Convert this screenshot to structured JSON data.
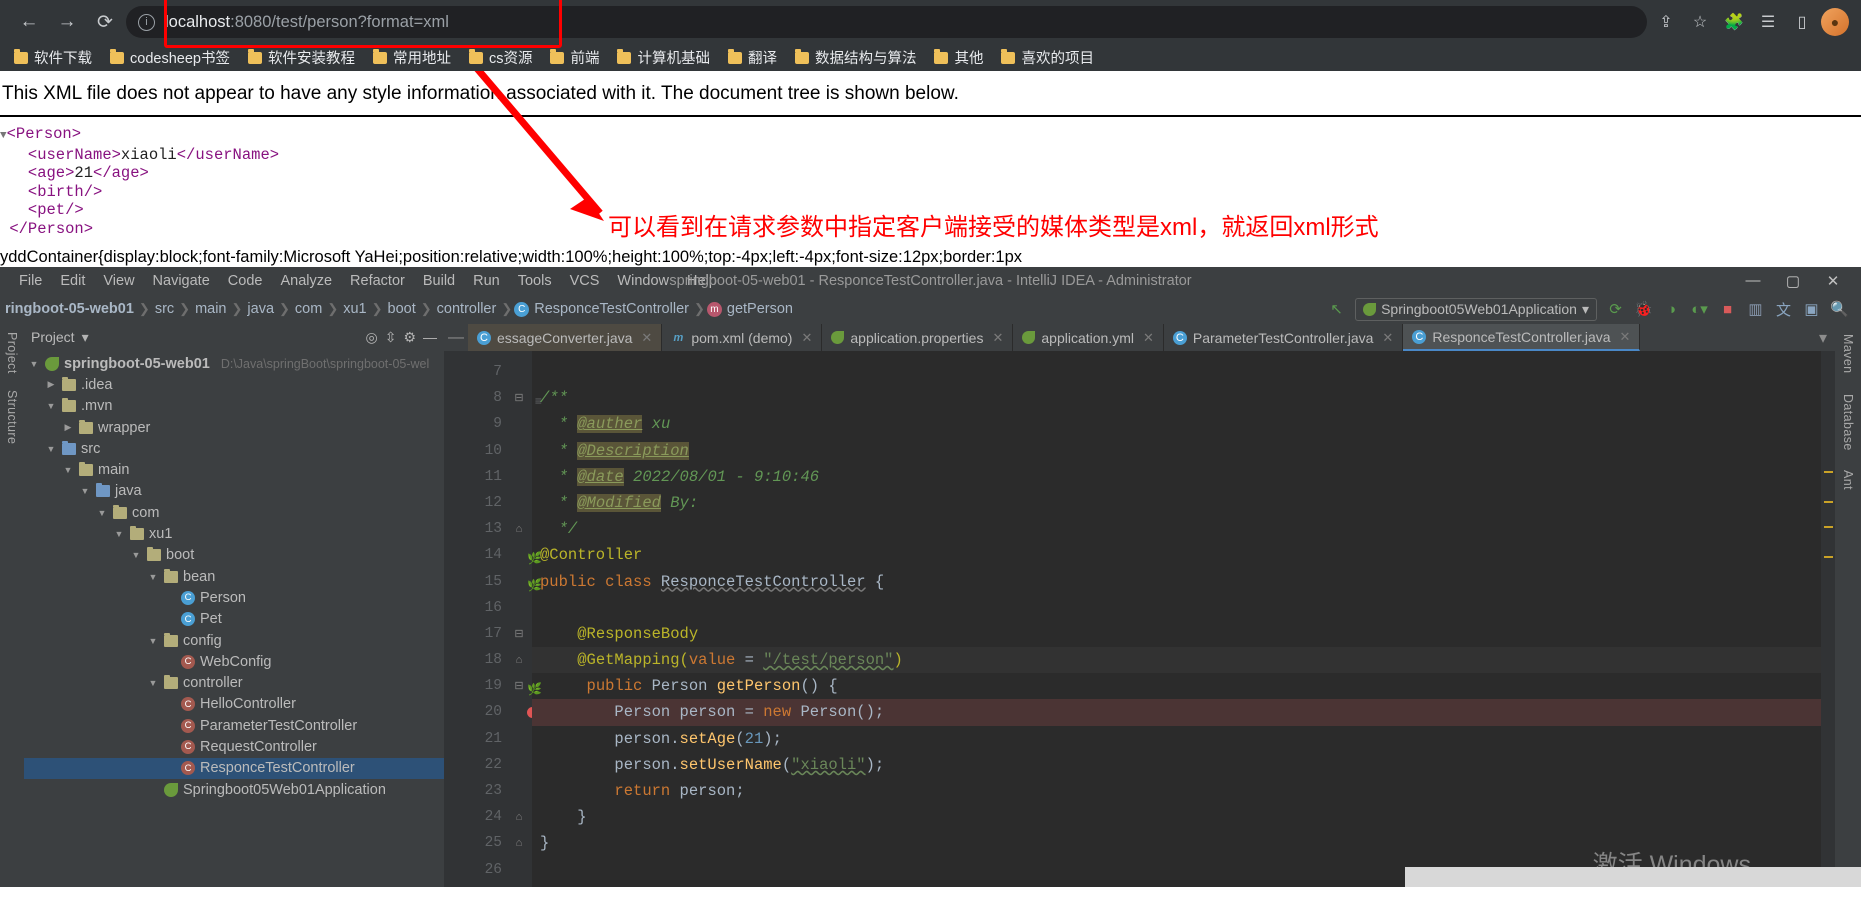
{
  "browser": {
    "nav": {
      "back": "←",
      "forward": "→",
      "reload": "⟳"
    },
    "url_prefix": "localhost",
    "url_suffix": ":8080/test/person?format=xml",
    "toolbar_icons": [
      "share-icon",
      "bookmark-star-icon",
      "extensions-icon",
      "reading-list-icon",
      "sidebar-icon"
    ],
    "bookmarks": [
      "软件下载",
      "codesheep书签",
      "软件安装教程",
      "常用地址",
      "cs资源",
      "前端",
      "计算机基础",
      "翻译",
      "数据结构与算法",
      "其他",
      "喜欢的项目"
    ]
  },
  "page": {
    "notice": "This XML file does not appear to have any style information associated with it. The document tree is shown below.",
    "xml_lines": [
      {
        "indent": 0,
        "triangle": true,
        "text": "<Person>"
      },
      {
        "indent": 1,
        "triangle": false,
        "text": "<userName>",
        "value": "xiaoli",
        "close": "</userName>"
      },
      {
        "indent": 1,
        "triangle": false,
        "text": "<age>",
        "value": "21",
        "close": "</age>"
      },
      {
        "indent": 1,
        "triangle": false,
        "text": "<birth/>"
      },
      {
        "indent": 1,
        "triangle": false,
        "text": "<pet/>"
      },
      {
        "indent": 0,
        "triangle": false,
        "text": "</Person>"
      }
    ],
    "css_leak": "yddContainer{display:block;font-family:Microsoft YaHei;position:relative;width:100%;height:100%;top:-4px;left:-4px;font-size:12px;border:1px",
    "annotation": "可以看到在请求参数中指定客户端接受的媒体类型是xml，就返回xml形式",
    "annotation_color": "#ff0000"
  },
  "ide": {
    "menu": [
      "File",
      "Edit",
      "View",
      "Navigate",
      "Code",
      "Analyze",
      "Refactor",
      "Build",
      "Run",
      "Tools",
      "VCS",
      "Window",
      "Help"
    ],
    "window_title": "springboot-05-web01 - ResponceTestController.java - IntelliJ IDEA - Administrator",
    "window_controls": [
      "—",
      "▢",
      "✕"
    ],
    "breadcrumbs": [
      "ringboot-05-web01",
      "src",
      "main",
      "java",
      "com",
      "xu1",
      "boot",
      "controller",
      "ResponceTestController",
      "getPerson"
    ],
    "run_config": "Springboot05Web01Application",
    "run_icons": [
      "build-icon",
      "debug-icon",
      "coverage-icon",
      "profiler-icon",
      "stop-icon",
      "git-icon",
      "translate-icon",
      "terminal-icon",
      "search-icon"
    ],
    "project": {
      "title": "Project",
      "header_icons": [
        "target-icon",
        "collapse-icon",
        "settings-icon",
        "hide-icon"
      ],
      "root": "springboot-05-web01",
      "root_path": "D:\\Java\\springBoot\\springboot-05-wel",
      "tree": [
        {
          "depth": 1,
          "arrow": "▶",
          "icon": "folder",
          "label": ".idea"
        },
        {
          "depth": 1,
          "arrow": "▼",
          "icon": "folder",
          "label": ".mvn"
        },
        {
          "depth": 2,
          "arrow": "▶",
          "icon": "folder",
          "label": "wrapper"
        },
        {
          "depth": 1,
          "arrow": "▼",
          "icon": "folder-src",
          "label": "src"
        },
        {
          "depth": 2,
          "arrow": "▼",
          "icon": "folder",
          "label": "main"
        },
        {
          "depth": 3,
          "arrow": "▼",
          "icon": "folder-src",
          "label": "java"
        },
        {
          "depth": 4,
          "arrow": "▼",
          "icon": "folder",
          "label": "com"
        },
        {
          "depth": 5,
          "arrow": "▼",
          "icon": "folder",
          "label": "xu1"
        },
        {
          "depth": 6,
          "arrow": "▼",
          "icon": "folder",
          "label": "boot"
        },
        {
          "depth": 7,
          "arrow": "▼",
          "icon": "folder",
          "label": "bean"
        },
        {
          "depth": 8,
          "arrow": "",
          "icon": "class",
          "label": "Person"
        },
        {
          "depth": 8,
          "arrow": "",
          "icon": "class",
          "label": "Pet"
        },
        {
          "depth": 7,
          "arrow": "▼",
          "icon": "folder",
          "label": "config"
        },
        {
          "depth": 8,
          "arrow": "",
          "icon": "class-cfg",
          "label": "WebConfig"
        },
        {
          "depth": 7,
          "arrow": "▼",
          "icon": "folder",
          "label": "controller"
        },
        {
          "depth": 8,
          "arrow": "",
          "icon": "class-cfg",
          "label": "HelloController"
        },
        {
          "depth": 8,
          "arrow": "",
          "icon": "class-cfg",
          "label": "ParameterTestController"
        },
        {
          "depth": 8,
          "arrow": "",
          "icon": "class-cfg",
          "label": "RequestController"
        },
        {
          "depth": 8,
          "arrow": "",
          "icon": "class-cfg",
          "label": "ResponceTestController",
          "selected": true
        },
        {
          "depth": 7,
          "arrow": "",
          "icon": "class-app",
          "label": "Springboot05Web01Application"
        }
      ]
    },
    "tabs": [
      {
        "label": "essageConverter.java",
        "icon": "class-icon",
        "state": "muted"
      },
      {
        "label": "pom.xml (demo)",
        "icon": "maven-icon",
        "state": "normal"
      },
      {
        "label": "application.properties",
        "icon": "spring-icon",
        "state": "normal"
      },
      {
        "label": "application.yml",
        "icon": "spring-icon",
        "state": "normal"
      },
      {
        "label": "ParameterTestController.java",
        "icon": "class-icon",
        "state": "normal"
      },
      {
        "label": "ResponceTestController.java",
        "icon": "class-icon",
        "state": "active"
      }
    ],
    "code": {
      "first_line": 7,
      "lines": [
        {
          "n": 7,
          "text": ""
        },
        {
          "n": 8,
          "html": "<span class='cmt'>/**</span>",
          "fold": "⊟",
          "gmark": "≡"
        },
        {
          "n": 9,
          "html": "  <span class='cmt'>* </span><span class='tag'>@auther</span><span class='cmt'> xu</span>"
        },
        {
          "n": 10,
          "html": "  <span class='cmt'>* </span><span class='tag'>@Description</span>"
        },
        {
          "n": 11,
          "html": "  <span class='cmt'>* </span><span class='tag'>@date</span><span class='cmt'> 2022/08/01 - 9:10:46</span>"
        },
        {
          "n": 12,
          "html": "  <span class='cmt'>* </span><span class='tag'>@Modified</span><span class='cmt'> By:</span>"
        },
        {
          "n": 13,
          "html": "  <span class='cmt'>*/</span>",
          "fold": "⌂"
        },
        {
          "n": 14,
          "html": "<span class='ann'>@Controller</span>",
          "gmark": "spring"
        },
        {
          "n": 15,
          "html": "<span class='kw'>public class </span><span class='cls-u'>ResponceTestController</span> {",
          "gmark": "spring-bean"
        },
        {
          "n": 16,
          "text": ""
        },
        {
          "n": 17,
          "html": "    <span class='ann'>@ResponseBody</span>",
          "fold": "⊟"
        },
        {
          "n": 18,
          "html": "    <span class='ann'>@GetMapping(</span><span class='kw'>value</span> = <span class='str-u'>\"/test/person\"</span><span class='ann'>)</span>",
          "bulb": true,
          "hl": "cur",
          "fold": "⌂"
        },
        {
          "n": 19,
          "html": "     <span class='kw'>public</span> Person <span class='fn'>getPerson</span>() {",
          "gmark": "spring-bean",
          "fold": "⊟"
        },
        {
          "n": 20,
          "html": "        Person person = <span class='kw'>new</span> <span class='typ'>Person</span>();",
          "hl": "red",
          "breakpoint": true
        },
        {
          "n": 21,
          "html": "        person.<span class='fn'>setAge</span>(<span class='num'>21</span>);"
        },
        {
          "n": 22,
          "html": "        person.<span class='fn'>setUserName</span>(<span class='str-u'>\"xiaoli\"</span>);"
        },
        {
          "n": 23,
          "html": "        <span class='kw'>return</span> person;"
        },
        {
          "n": 24,
          "html": "    }",
          "fold": "⌂"
        },
        {
          "n": 25,
          "html": "}",
          "fold": "⌂"
        },
        {
          "n": 26,
          "text": ""
        }
      ]
    },
    "left_rail": [
      "Project",
      "Structure"
    ],
    "right_rail": [
      "Maven",
      "Database",
      "Ant"
    ],
    "watermark": "激活 Windows"
  }
}
